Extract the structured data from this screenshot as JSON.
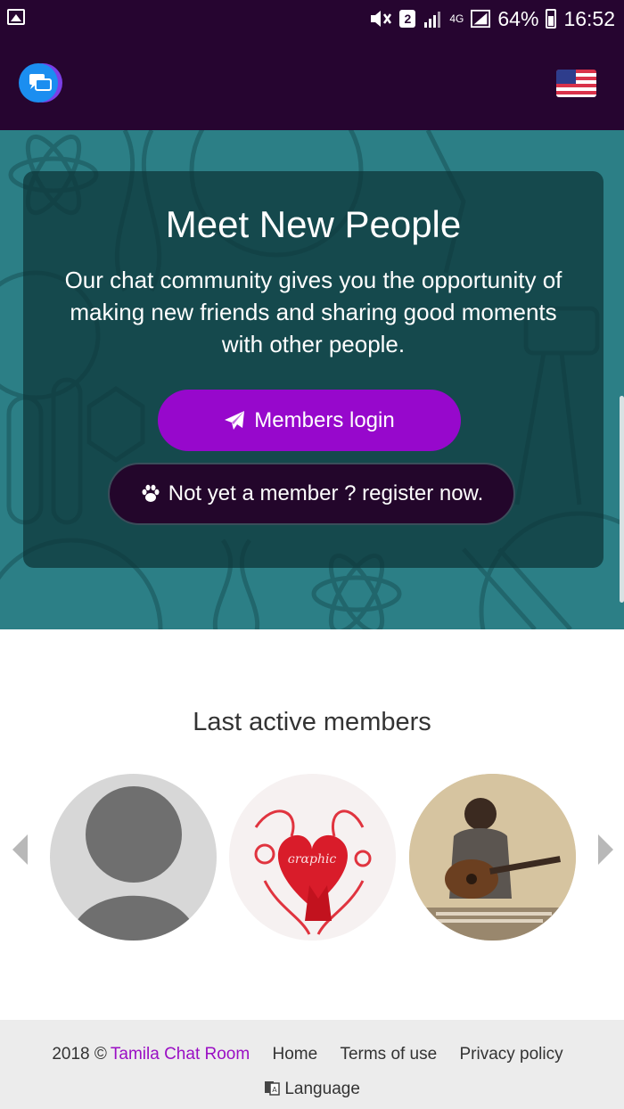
{
  "status_bar": {
    "sim_number": "2",
    "network": "4G",
    "battery": "64%",
    "time": "16:52",
    "icons": [
      "photo-icon",
      "mute-icon",
      "signal-icon",
      "battery-icon"
    ]
  },
  "header": {
    "logo_icon": "chat-bubbles-icon",
    "language_flag_icon": "us-flag-icon"
  },
  "hero": {
    "title": "Meet New People",
    "description": "Our chat community gives you the opportunity of making new friends and sharing good moments with other people.",
    "login_button": "Members login",
    "login_icon": "paper-plane-icon",
    "register_button": "Not yet a member ? register now.",
    "register_icon": "paw-icon"
  },
  "members": {
    "title": "Last active members",
    "avatars": [
      "default-avatar",
      "heart-art-avatar",
      "guitar-player-avatar"
    ]
  },
  "footer": {
    "year": "2018 ©",
    "brand": "Tamila Chat Room",
    "home": "Home",
    "terms": "Terms of use",
    "privacy": "Privacy policy",
    "language": "Language"
  },
  "colors": {
    "header_bg": "#260530",
    "hero_bg": "#2c7f86",
    "accent": "#9708cc",
    "register_bg": "#23062b",
    "footer_bg": "#ececec",
    "brand_link": "#9a0fc4"
  }
}
